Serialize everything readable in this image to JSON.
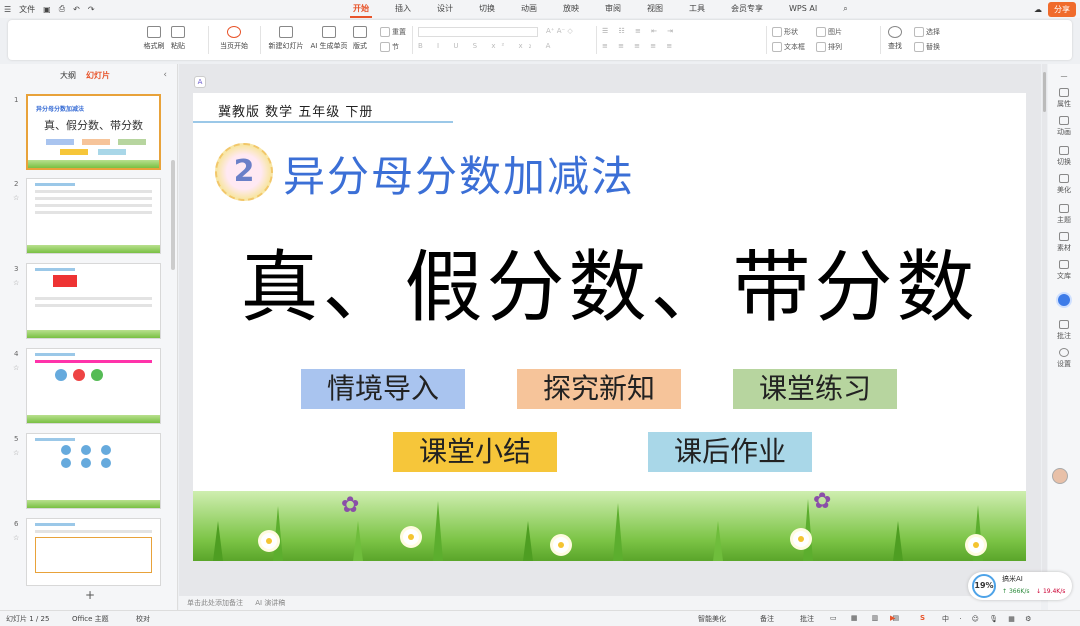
{
  "titlebar": {
    "menu": "文件",
    "tabs": [
      "开始",
      "插入",
      "设计",
      "切换",
      "动画",
      "放映",
      "审阅",
      "视图",
      "工具",
      "会员专享"
    ],
    "active_tab": "开始",
    "wps_ai": "WPS AI",
    "share": "分享"
  },
  "ribbon": {
    "format_painter": "格式刷",
    "paste": "粘贴",
    "play_from_current": "当页开始",
    "new_slide": "新建幻灯片",
    "ai_generate": "AI 生成单页",
    "layout": "版式",
    "section": "节",
    "reset": "重置",
    "shape": "形状",
    "picture": "图片",
    "textbox": "文本框",
    "arrange": "排列",
    "find": "查找",
    "select": "选择",
    "replace": "替换"
  },
  "left_pane": {
    "tab_outline": "大纲",
    "tab_slides": "幻灯片",
    "active": "幻灯片",
    "slide_numbers": [
      "1",
      "2",
      "3",
      "4",
      "5",
      "6"
    ]
  },
  "slide": {
    "header": "冀教版   数学   五年级   下册",
    "chapter_number": "2",
    "subtitle": "异分母分数加减法",
    "title": "真、假分数、带分数",
    "buttons": [
      {
        "label": "情境导入",
        "color": "#a9c4ef"
      },
      {
        "label": "探究新知",
        "color": "#f6c49a"
      },
      {
        "label": "课堂练习",
        "color": "#b7d59f"
      },
      {
        "label": "课堂小结",
        "color": "#f6c63a"
      },
      {
        "label": "课后作业",
        "color": "#a9d7e8"
      }
    ]
  },
  "notes_placeholder": "单击此处添加备注",
  "notes_ai": "AI 演讲稿",
  "right_sidebar": [
    "属性",
    "动画",
    "切换",
    "美化",
    "主题",
    "素材",
    "文库",
    "批注",
    "设置"
  ],
  "statusbar": {
    "slide_counter": "幻灯片 1 / 25",
    "theme": "Office 主题",
    "proofing": "校对",
    "smart_beautify": "智能美化",
    "notes": "备注",
    "comment": "批注"
  },
  "ai_widget": {
    "percent": "19%",
    "name": "搞米AI",
    "upload": "366K/s",
    "download": "19.4K/s"
  }
}
